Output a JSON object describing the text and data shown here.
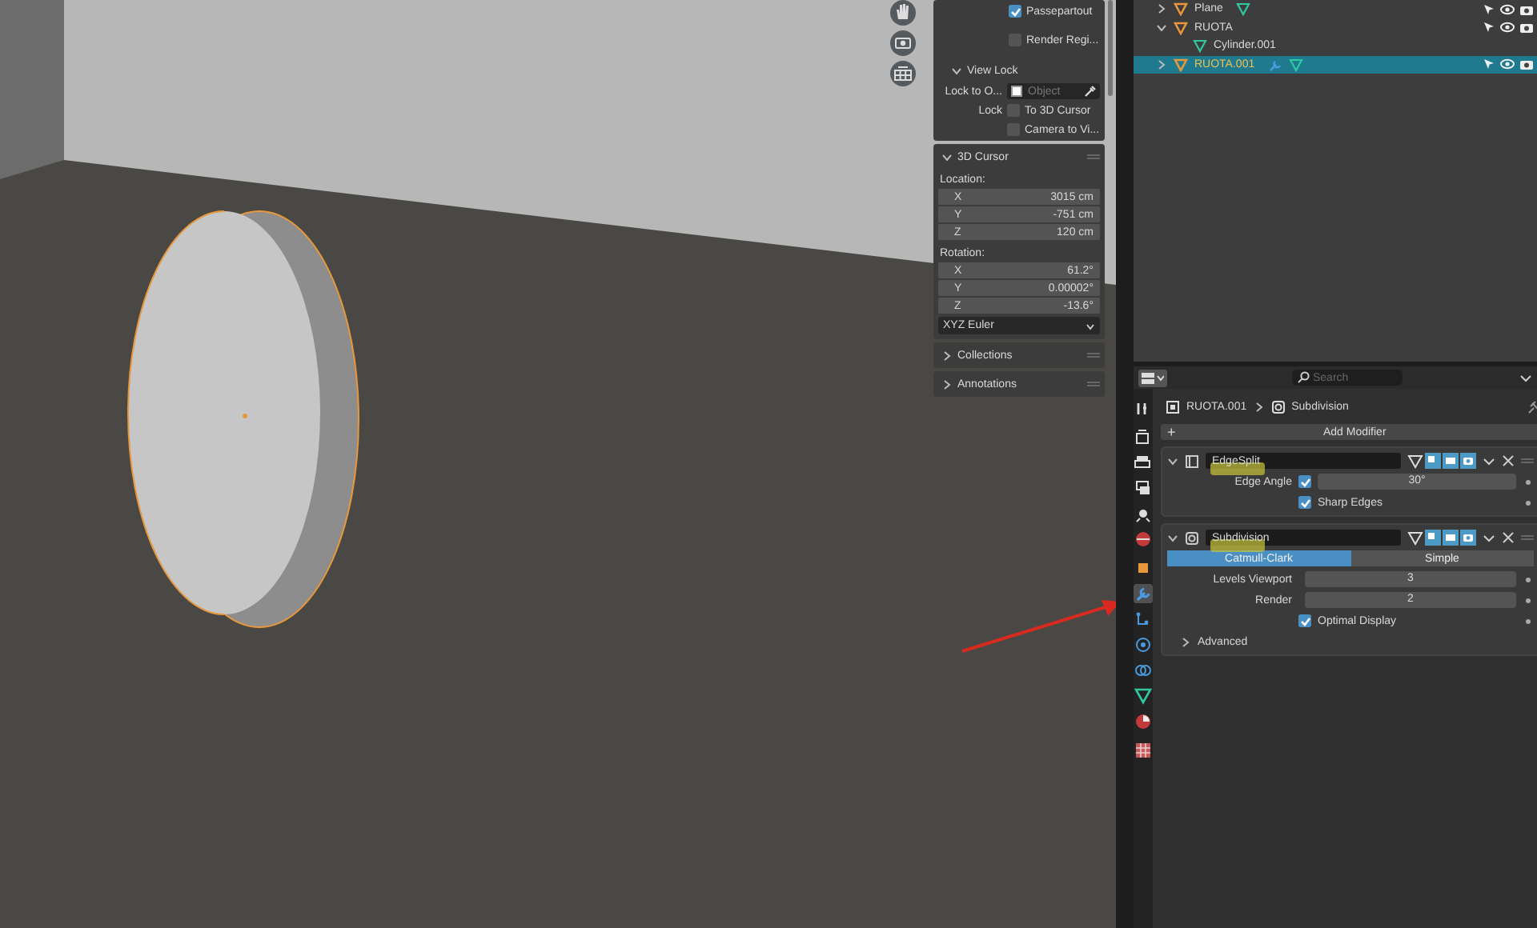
{
  "viewport": {
    "sidebar": {
      "display_options": [
        {
          "label": "Passepartout",
          "checked": true
        },
        {
          "label": "Render Regi...",
          "checked": false
        }
      ],
      "view_lock": {
        "title": "View Lock",
        "expanded": true,
        "lock_to_object_label": "Lock to O...",
        "object_placeholder": "Object",
        "lock_label": "Lock",
        "options": [
          {
            "label": "To 3D Cursor",
            "checked": false
          },
          {
            "label": "Camera to Vi...",
            "checked": false
          }
        ]
      },
      "cursor": {
        "title": "3D Cursor",
        "expanded": true,
        "location_label": "Location:",
        "location": [
          {
            "axis": "X",
            "value": "3015 cm"
          },
          {
            "axis": "Y",
            "value": "-751 cm"
          },
          {
            "axis": "Z",
            "value": "120 cm"
          }
        ],
        "rotation_label": "Rotation:",
        "rotation": [
          {
            "axis": "X",
            "value": "61.2°"
          },
          {
            "axis": "Y",
            "value": "0.00002°"
          },
          {
            "axis": "Z",
            "value": "-13.6°"
          }
        ],
        "rotation_mode": "XYZ Euler"
      },
      "panels": [
        {
          "title": "Collections",
          "expanded": false
        },
        {
          "title": "Annotations",
          "expanded": false
        }
      ]
    }
  },
  "outliner": {
    "rows": [
      {
        "name": "Plane",
        "kind": "object",
        "expanded": false,
        "selected": false,
        "modifier": false,
        "data_icon": true
      },
      {
        "name": "RUOTA",
        "kind": "object",
        "expanded": true,
        "selected": false,
        "modifier": false,
        "data_icon": false,
        "children": [
          {
            "name": "Cylinder.001",
            "kind": "mesh",
            "selected": false
          }
        ]
      },
      {
        "name": "RUOTA.001",
        "kind": "object",
        "expanded": false,
        "selected": true,
        "modifier": true,
        "data_icon": true
      }
    ]
  },
  "properties": {
    "search": {
      "placeholder": "Search"
    },
    "tab_groups": [
      [
        {
          "kind": "tool",
          "selected": false
        }
      ],
      [
        {
          "kind": "render",
          "selected": false
        },
        {
          "kind": "output",
          "selected": false
        },
        {
          "kind": "view_layer",
          "selected": false
        },
        {
          "kind": "scene",
          "selected": false
        },
        {
          "kind": "world",
          "selected": false
        }
      ],
      [
        {
          "kind": "object",
          "selected": false
        },
        {
          "kind": "modifiers",
          "selected": true
        },
        {
          "kind": "particles",
          "selected": false
        },
        {
          "kind": "physics",
          "selected": false
        },
        {
          "kind": "constraints",
          "selected": false
        },
        {
          "kind": "data",
          "selected": false
        },
        {
          "kind": "material",
          "selected": false
        }
      ],
      [
        {
          "kind": "texture",
          "selected": false
        }
      ]
    ],
    "breadcrumb": {
      "object": "RUOTA.001",
      "modifier": "Subdivision"
    },
    "add_modifier": {
      "icon": "+",
      "label": "Add Modifier"
    },
    "modifiers": [
      {
        "kind": "edgesplit",
        "name": "EdgeSplit",
        "expanded": true,
        "highlighted": true,
        "rows": [
          {
            "kind": "check_value",
            "label": "Edge Angle",
            "checked": true,
            "value": "30°"
          },
          {
            "kind": "checkbox",
            "label": "Sharp Edges",
            "checked": true
          }
        ]
      },
      {
        "kind": "subdivision",
        "name": "Subdivision",
        "expanded": true,
        "highlighted": true,
        "rows": [
          {
            "kind": "segmented",
            "options": [
              {
                "label": "Catmull-Clark",
                "selected": true
              },
              {
                "label": "Simple",
                "selected": false
              }
            ]
          },
          {
            "kind": "number",
            "label": "Levels Viewport",
            "value": "3"
          },
          {
            "kind": "number",
            "label": "Render",
            "value": "2"
          },
          {
            "kind": "checkbox",
            "label": "Optimal Display",
            "checked": true
          },
          {
            "kind": "subpanel",
            "label": "Advanced",
            "expanded": false
          }
        ]
      }
    ]
  }
}
